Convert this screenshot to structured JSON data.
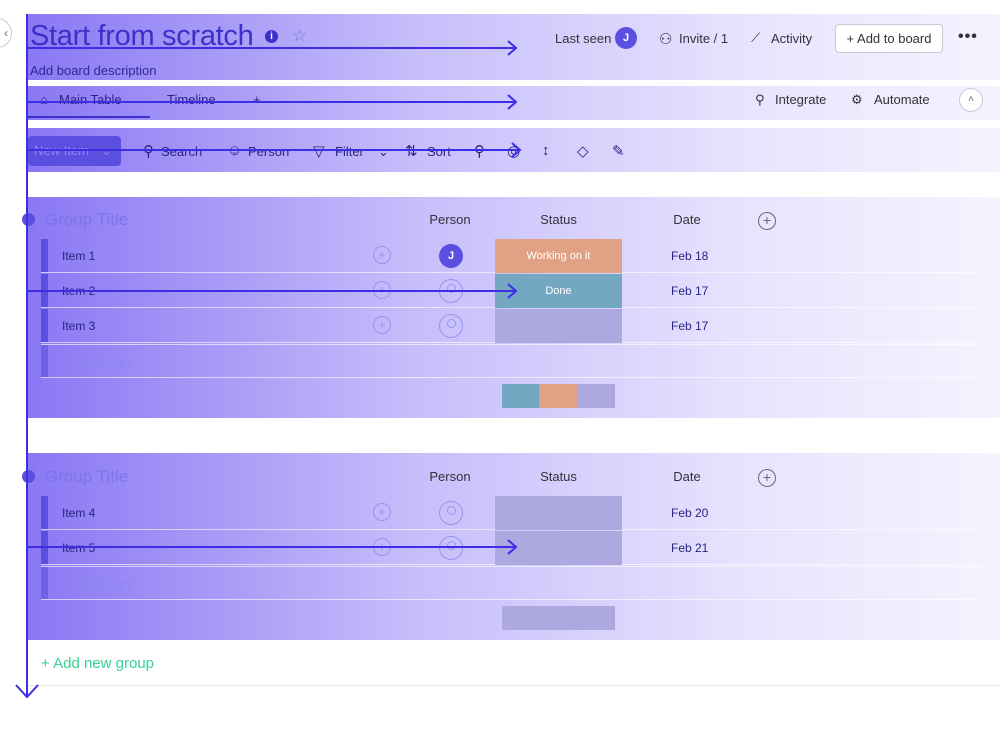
{
  "header": {
    "title": "Start from scratch",
    "description": "Add board description",
    "last_seen_label": "Last seen",
    "last_seen_avatar": "J",
    "invite_label": "Invite / 1",
    "activity_label": "Activity",
    "add_to_board_label": "+ Add to board",
    "more_label": "•••"
  },
  "tabs": {
    "main_table": "Main Table",
    "timeline": "Timeline",
    "add": "+",
    "integrate": "Integrate",
    "automate": "Automate"
  },
  "toolbar": {
    "new_item": "New Item",
    "search": "Search",
    "person": "Person",
    "filter": "Filter",
    "sort": "Sort"
  },
  "columns": {
    "person": "Person",
    "status": "Status",
    "date": "Date"
  },
  "groups": [
    {
      "title": "Group Title",
      "rows": [
        {
          "name": "Item 1",
          "person": "J",
          "status": "Working on it",
          "status_color": "#fdab3d",
          "date": "Feb 18"
        },
        {
          "name": "Item 2",
          "person": "",
          "status": "Done",
          "status_color": "#00c875",
          "date": "Feb 17"
        },
        {
          "name": "Item 3",
          "person": "",
          "status": "",
          "status_color": "#c4c4c4",
          "date": "Feb 17"
        }
      ],
      "add_item": "+ Add Item"
    },
    {
      "title": "Group Title",
      "rows": [
        {
          "name": "Item 4",
          "person": "",
          "status": "",
          "status_color": "#c4c4c4",
          "date": "Feb 20"
        },
        {
          "name": "Item 5",
          "person": "",
          "status": "",
          "status_color": "#c4c4c4",
          "date": "Feb 21"
        }
      ],
      "add_item": "+ Add Item"
    }
  ],
  "add_new_group": "+ Add new group",
  "colors": {
    "accent": "#5b4fe0",
    "overlay_purple": "#7a65f2",
    "add_group_green": "#33d391"
  }
}
